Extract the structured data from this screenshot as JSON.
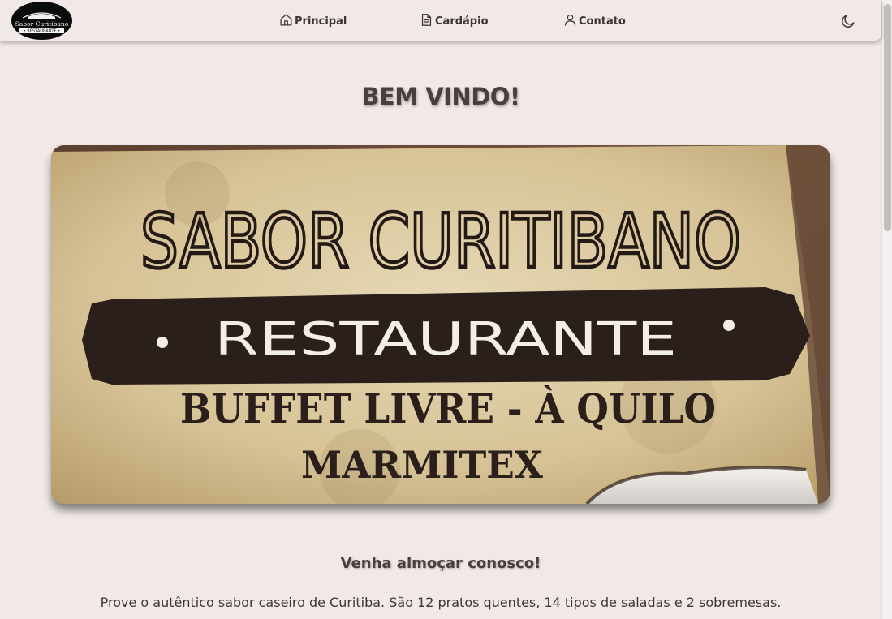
{
  "nav": {
    "logo": {
      "line1": "Sabor Curitibano",
      "line2": "• RESTAURANTE •"
    },
    "items": [
      {
        "label": "Principal",
        "icon": "home-icon"
      },
      {
        "label": "Cardápio",
        "icon": "document-icon"
      },
      {
        "label": "Contato",
        "icon": "user-icon"
      }
    ],
    "theme_toggle_icon": "moon-icon"
  },
  "main": {
    "title": "BEM VINDO!",
    "banner": {
      "brand": "SABOR CURITIBANO",
      "ribbon": "RESTAURANTE",
      "line1": "BUFFET LIVRE - À QUILO",
      "line2": "MARMITEX"
    },
    "subtitle": "Venha almoçar conosco!",
    "description": "Prove o autêntico sabor caseiro de Curitiba. São 12 pratos quentes, 14 tipos de saladas e 2 sobremesas."
  },
  "colors": {
    "background": "#f1e9e7",
    "text": "#4a3f3a",
    "banner_parchment": "#d9c69b",
    "banner_ribbon": "#2a1f1b"
  }
}
